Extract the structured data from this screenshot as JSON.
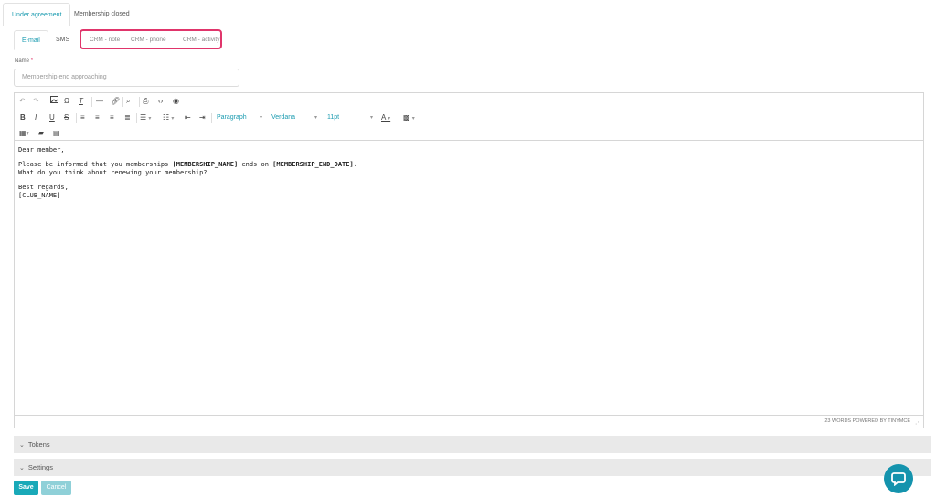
{
  "top_tabs": [
    "Under agreement",
    "Membership closed"
  ],
  "sub_tabs": [
    "E-mail",
    "SMS",
    "CRM - note",
    "CRM - phone",
    "CRM - activity"
  ],
  "name_field": {
    "label": "Name",
    "required_mark": "*",
    "value": "Membership end approaching"
  },
  "toolbar": {
    "format_select": "Paragraph",
    "font_select": "Verdana",
    "size_select": "11pt"
  },
  "editor": {
    "greeting": "Dear member,",
    "line1_before": "Please be informed that you memberships ",
    "token_name": "[MEMBERSHIP_NAME]",
    "line1_middle": " ends on ",
    "token_date": "[MEMBERSHIP_END_DATE]",
    "line1_end": ".",
    "line2": "What do you think about renewing your membership?",
    "closing": "Best regards,",
    "signature": "[CLUB_NAME]",
    "status": "23 WORDS POWERED BY TINYMCE"
  },
  "accordions": {
    "tokens": "Tokens",
    "settings": "Settings"
  },
  "buttons": {
    "save": "Save",
    "cancel": "Cancel"
  },
  "colors": {
    "accent": "#19a9b8",
    "highlight": "#e0356b"
  }
}
